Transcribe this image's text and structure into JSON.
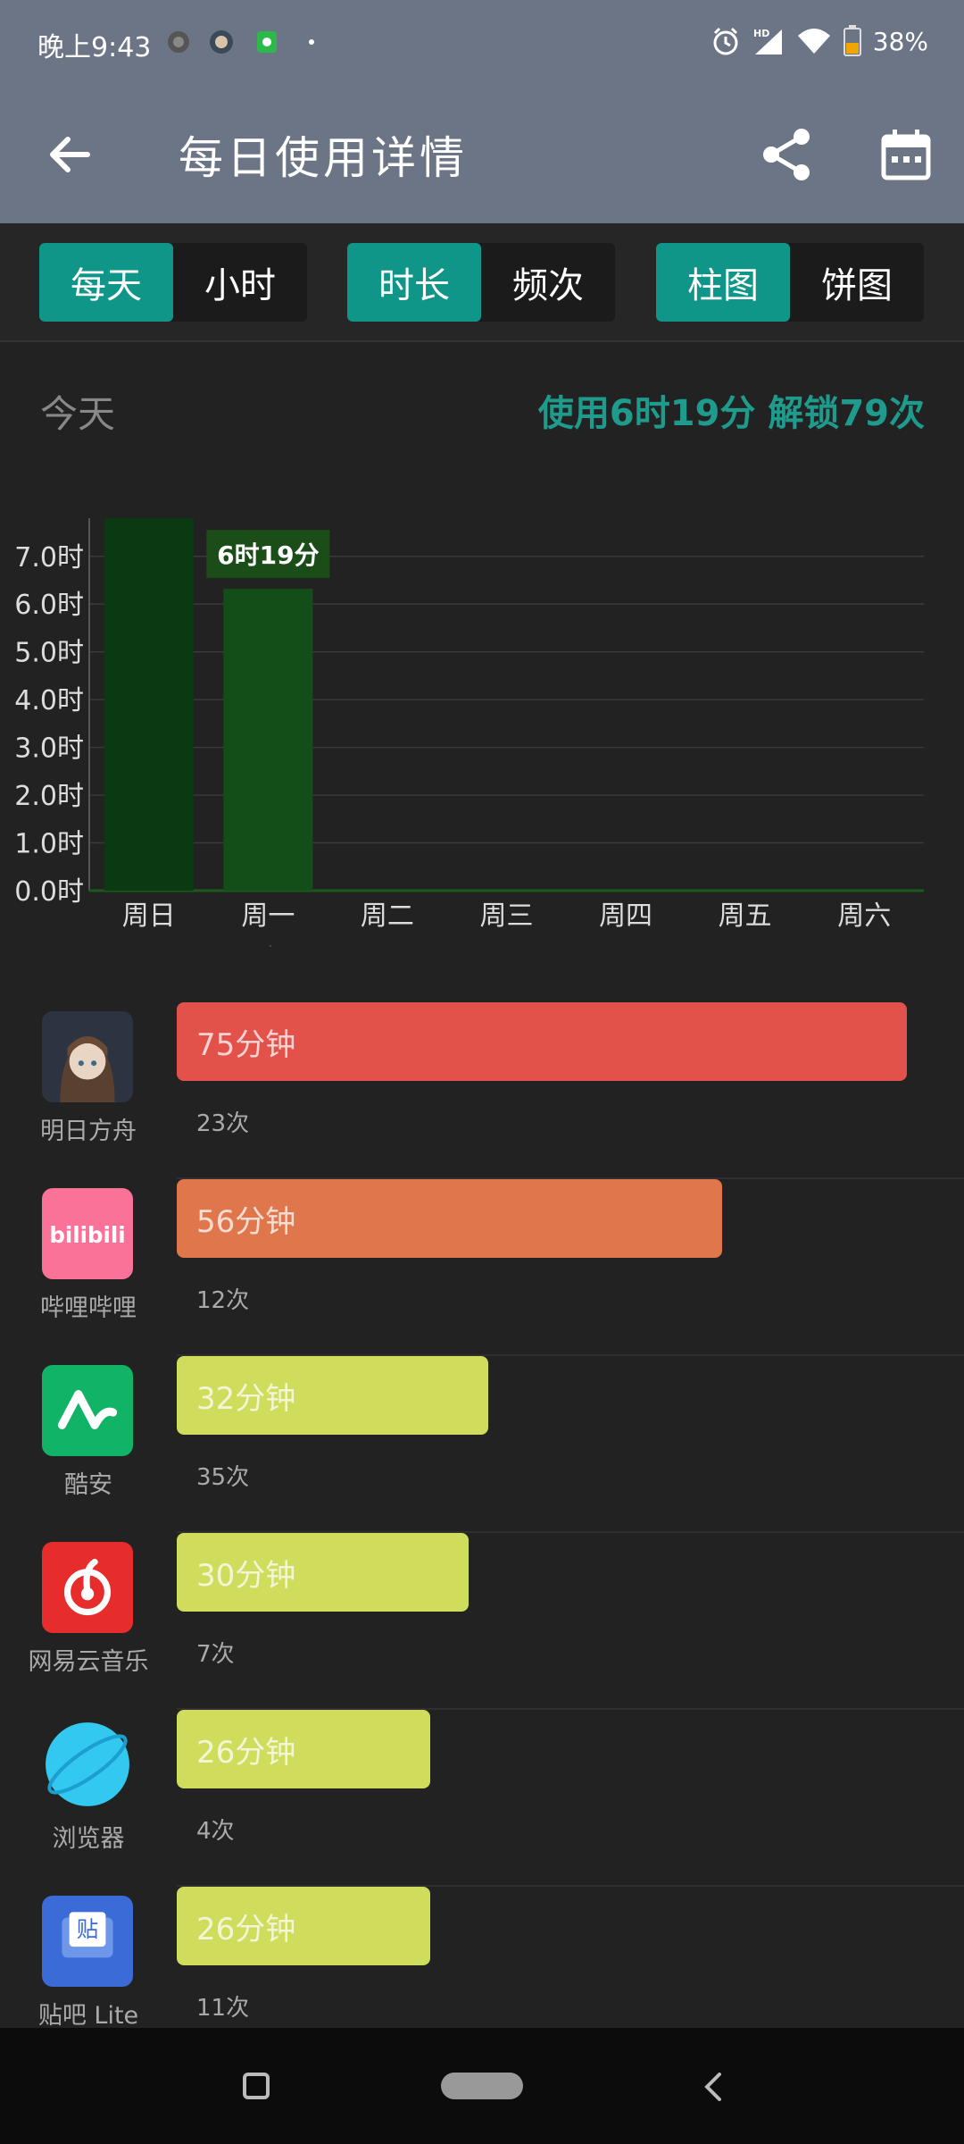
{
  "status": {
    "time": "晚上9:43",
    "battery": "38%",
    "icons": [
      "alarm-icon",
      "hd-signal-icon",
      "wifi-icon",
      "battery-icon"
    ]
  },
  "appbar": {
    "title": "每日使用详情",
    "back_icon": "arrow-left-icon",
    "share_icon": "share-icon",
    "calendar_icon": "calendar-icon"
  },
  "toggles": {
    "period": {
      "active": "每天",
      "inactive": "小时"
    },
    "metric": {
      "active": "时长",
      "inactive": "频次"
    },
    "view": {
      "active": "柱图",
      "inactive": "饼图"
    }
  },
  "summary": {
    "day_label": "今天",
    "usage_text": "使用6时19分 解锁79次"
  },
  "chart_data": {
    "type": "bar",
    "categories": [
      "周日",
      "周一",
      "周二",
      "周三",
      "周四",
      "周五",
      "周六"
    ],
    "values": [
      7.8,
      6.32,
      0,
      0,
      0,
      0,
      0
    ],
    "value_unit": "时",
    "y_ticks": [
      "7.0时",
      "6.0时",
      "5.0时",
      "4.0时",
      "3.0时",
      "2.0时",
      "1.0时",
      "0.0时"
    ],
    "ylim": [
      0,
      7.8
    ],
    "highlight_index": 1,
    "highlight_label": "6时19分",
    "grid": true,
    "colors": {
      "bar": "#0b3a12",
      "bar_selected": "#134d18",
      "grid": "#3a3a3a",
      "label_bg": "#1b4d18"
    }
  },
  "apps": [
    {
      "name": "明日方舟",
      "duration": "75分钟",
      "minutes": 75,
      "count": "23次",
      "color": "#e3524a",
      "icon": "arknights-icon"
    },
    {
      "name": "哔哩哔哩",
      "duration": "56分钟",
      "minutes": 56,
      "count": "12次",
      "color": "#e0764c",
      "icon": "bilibili-icon"
    },
    {
      "name": "酷安",
      "duration": "32分钟",
      "minutes": 32,
      "count": "35次",
      "color": "#cfdc5c",
      "icon": "coolapk-icon"
    },
    {
      "name": "网易云音乐",
      "duration": "30分钟",
      "minutes": 30,
      "count": "7次",
      "color": "#cfdc5c",
      "icon": "netease-music-icon"
    },
    {
      "name": "浏览器",
      "duration": "26分钟",
      "minutes": 26,
      "count": "4次",
      "color": "#cfdc5c",
      "icon": "browser-icon"
    },
    {
      "name": "贴吧 Lite",
      "duration": "26分钟",
      "minutes": 26,
      "count": "11次",
      "color": "#cfdc5c",
      "icon": "tieba-icon"
    }
  ]
}
